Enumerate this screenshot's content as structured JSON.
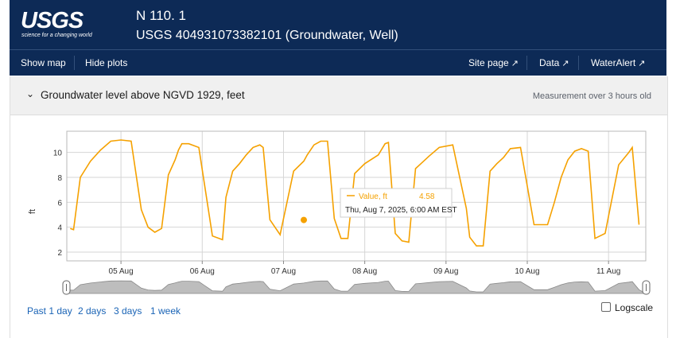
{
  "header": {
    "logo_text": "USGS",
    "logo_tagline": "science for a changing world",
    "site_name": "N 110. 1",
    "site_full": "USGS 404931073382101 (Groundwater, Well)"
  },
  "nav": {
    "show_map": "Show map",
    "hide_plots": "Hide plots",
    "site_page": "Site page",
    "data": "Data",
    "water_alert": "WaterAlert"
  },
  "panel": {
    "title": "Groundwater level above NGVD 1929, feet",
    "status": "Measurement over 3 hours old"
  },
  "tooltip": {
    "series": "Value, ft",
    "value": "4.58",
    "datetime": "Thu, Aug 7, 2025, 6:00 AM EST"
  },
  "controls": {
    "ranges": [
      "Past 1 day",
      "2 days",
      "3 days",
      "1 week"
    ],
    "logscale_label": "Logscale",
    "logscale_checked": false
  },
  "colors": {
    "header_bg": "#0d2a56",
    "series": "#f5a100",
    "link": "#1a64b6"
  },
  "chart_data": {
    "type": "line",
    "title": "",
    "xlabel": "",
    "ylabel": "ft",
    "xlim": [
      "2025-08-04T08:00",
      "2025-08-11T11:00"
    ],
    "ylim": [
      1.3,
      11.7
    ],
    "yticks": [
      2,
      4,
      6,
      8,
      10
    ],
    "xticks": [
      "05 Aug",
      "06 Aug",
      "07 Aug",
      "08 Aug",
      "09 Aug",
      "10 Aug",
      "11 Aug"
    ],
    "grid": true,
    "series": [
      {
        "name": "Value, ft",
        "x": [
          "2025-08-04T09:00",
          "2025-08-04T10:00",
          "2025-08-04T12:00",
          "2025-08-04T15:00",
          "2025-08-04T18:00",
          "2025-08-04T21:00",
          "2025-08-05T00:00",
          "2025-08-05T03:00",
          "2025-08-05T06:00",
          "2025-08-05T08:00",
          "2025-08-05T10:00",
          "2025-08-05T12:00",
          "2025-08-05T14:00",
          "2025-08-05T16:00",
          "2025-08-05T17:00",
          "2025-08-05T18:00",
          "2025-08-05T20:00",
          "2025-08-05T23:00",
          "2025-08-06T03:00",
          "2025-08-06T06:00",
          "2025-08-06T07:00",
          "2025-08-06T09:00",
          "2025-08-06T11:00",
          "2025-08-06T13:00",
          "2025-08-06T15:00",
          "2025-08-06T17:00",
          "2025-08-06T18:00",
          "2025-08-06T20:00",
          "2025-08-06T23:00",
          "2025-08-07T03:00",
          "2025-08-07T06:00",
          "2025-08-07T07:00",
          "2025-08-07T09:00",
          "2025-08-07T11:00",
          "2025-08-07T13:00",
          "2025-08-07T15:00",
          "2025-08-07T17:00",
          "2025-08-07T19:00",
          "2025-08-07T21:00",
          "2025-08-08T00:00",
          "2025-08-08T04:00",
          "2025-08-08T06:00",
          "2025-08-08T07:00",
          "2025-08-08T09:00",
          "2025-08-08T11:00",
          "2025-08-08T13:00",
          "2025-08-08T15:00",
          "2025-08-08T17:00",
          "2025-08-08T19:00",
          "2025-08-08T22:00",
          "2025-08-09T02:00",
          "2025-08-09T06:00",
          "2025-08-09T07:00",
          "2025-08-09T09:00",
          "2025-08-09T11:00",
          "2025-08-09T13:00",
          "2025-08-09T15:00",
          "2025-08-09T17:00",
          "2025-08-09T19:00",
          "2025-08-09T22:00",
          "2025-08-10T02:00",
          "2025-08-10T06:00",
          "2025-08-10T08:00",
          "2025-08-10T10:00",
          "2025-08-10T12:00",
          "2025-08-10T14:00",
          "2025-08-10T16:00",
          "2025-08-10T18:00",
          "2025-08-10T20:00",
          "2025-08-10T23:00",
          "2025-08-11T03:00",
          "2025-08-11T06:00",
          "2025-08-11T07:00",
          "2025-08-11T09:00"
        ],
        "y": [
          3.9,
          3.8,
          8.0,
          9.3,
          10.2,
          10.9,
          11.0,
          10.9,
          5.4,
          4.0,
          3.6,
          3.9,
          8.2,
          9.4,
          10.2,
          10.7,
          10.7,
          10.4,
          3.3,
          3.0,
          6.4,
          8.5,
          9.1,
          9.8,
          10.4,
          10.6,
          10.4,
          4.6,
          3.4,
          8.5,
          9.3,
          9.8,
          10.6,
          10.9,
          10.9,
          4.7,
          3.1,
          3.1,
          8.3,
          9.1,
          9.8,
          10.7,
          10.8,
          3.5,
          2.9,
          2.8,
          8.7,
          9.2,
          9.7,
          10.4,
          10.6,
          5.5,
          3.2,
          2.5,
          2.5,
          8.5,
          9.1,
          9.6,
          10.3,
          10.4,
          4.2,
          4.2,
          6.0,
          8.0,
          9.4,
          10.1,
          10.3,
          10.1,
          3.1,
          3.5,
          9.0,
          10.0,
          10.4,
          4.2
        ]
      }
    ],
    "marker": {
      "x": "2025-08-07T06:00",
      "y": 4.58
    }
  }
}
